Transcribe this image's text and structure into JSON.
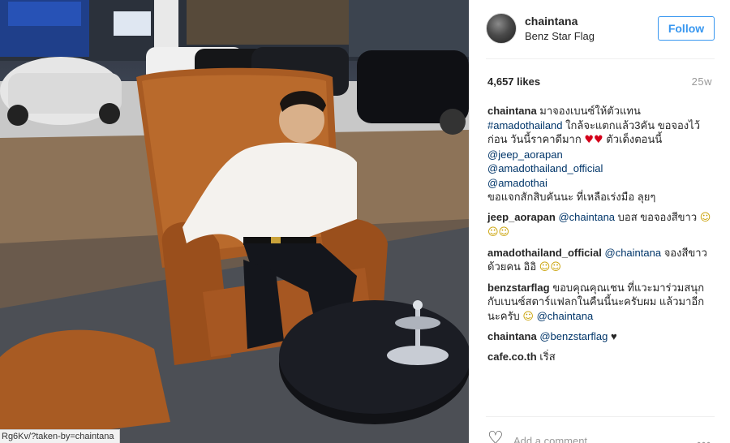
{
  "post": {
    "username": "chaintana",
    "location": "Benz Star Flag",
    "follow_label": "Follow",
    "likes": "4,657 likes",
    "age": "25w",
    "status_url": "Rg6Kv/?taken-by=chaintana"
  },
  "comments": [
    {
      "user": "chaintana",
      "parts": [
        {
          "t": "text",
          "v": " มาจองเบนซ์ให้ตัวแทน "
        },
        {
          "t": "tag",
          "v": "#amadothailand"
        },
        {
          "t": "text",
          "v": " ใกล้จะแตกแล้ว3คัน ขอจองไว้ก่อน วันนี้ราคาดีมาก "
        },
        {
          "t": "heart",
          "v": "♥♥"
        },
        {
          "t": "text",
          "v": " ตัวเด็งตอนนี้ "
        },
        {
          "t": "br"
        },
        {
          "t": "mention",
          "v": "@jeep_aorapan"
        },
        {
          "t": "br"
        },
        {
          "t": "mention",
          "v": "@amadothailand_official"
        },
        {
          "t": "br"
        },
        {
          "t": "mention",
          "v": "@amadothai"
        },
        {
          "t": "br"
        },
        {
          "t": "text",
          "v": "ขอแจกสักสิบคันนะ ที่เหลือเร่งมือ ลุยๆ"
        }
      ]
    },
    {
      "user": "jeep_aorapan",
      "parts": [
        {
          "t": "text",
          "v": " "
        },
        {
          "t": "mention",
          "v": "@chaintana"
        },
        {
          "t": "text",
          "v": " บอส ขอจองสีขาว "
        },
        {
          "t": "smile",
          "v": "☺☺☺"
        }
      ]
    },
    {
      "user": "amadothailand_official",
      "parts": [
        {
          "t": "text",
          "v": " "
        },
        {
          "t": "mention",
          "v": "@chaintana"
        },
        {
          "t": "text",
          "v": " จองสีขาว ด้วยคน อิอิ "
        },
        {
          "t": "smile",
          "v": "☺☺"
        }
      ]
    },
    {
      "user": "benzstarflag",
      "parts": [
        {
          "t": "text",
          "v": " ขอบคุณคุณเชน ที่แวะมาร่วมสนุกกับเบนซ์สตาร์แฟลกในคืนนี้นะครับผม แล้วมาอีกนะครับ "
        },
        {
          "t": "smile",
          "v": "☺"
        },
        {
          "t": "text",
          "v": " "
        },
        {
          "t": "mention",
          "v": "@chaintana"
        }
      ]
    },
    {
      "user": "chaintana",
      "parts": [
        {
          "t": "text",
          "v": " "
        },
        {
          "t": "mention",
          "v": "@benzstarflag"
        },
        {
          "t": "text",
          "v": " ♥"
        }
      ]
    },
    {
      "user": "cafe.co.th",
      "parts": [
        {
          "t": "text",
          "v": " เริ่ส"
        }
      ]
    }
  ],
  "footer": {
    "heart_icon": "heart-outline-icon",
    "add_comment_placeholder": "Add a comment...",
    "more_icon": "ellipsis-icon"
  },
  "colors": {
    "link": "#003569",
    "follow": "#3897f0",
    "muted": "#999999"
  }
}
